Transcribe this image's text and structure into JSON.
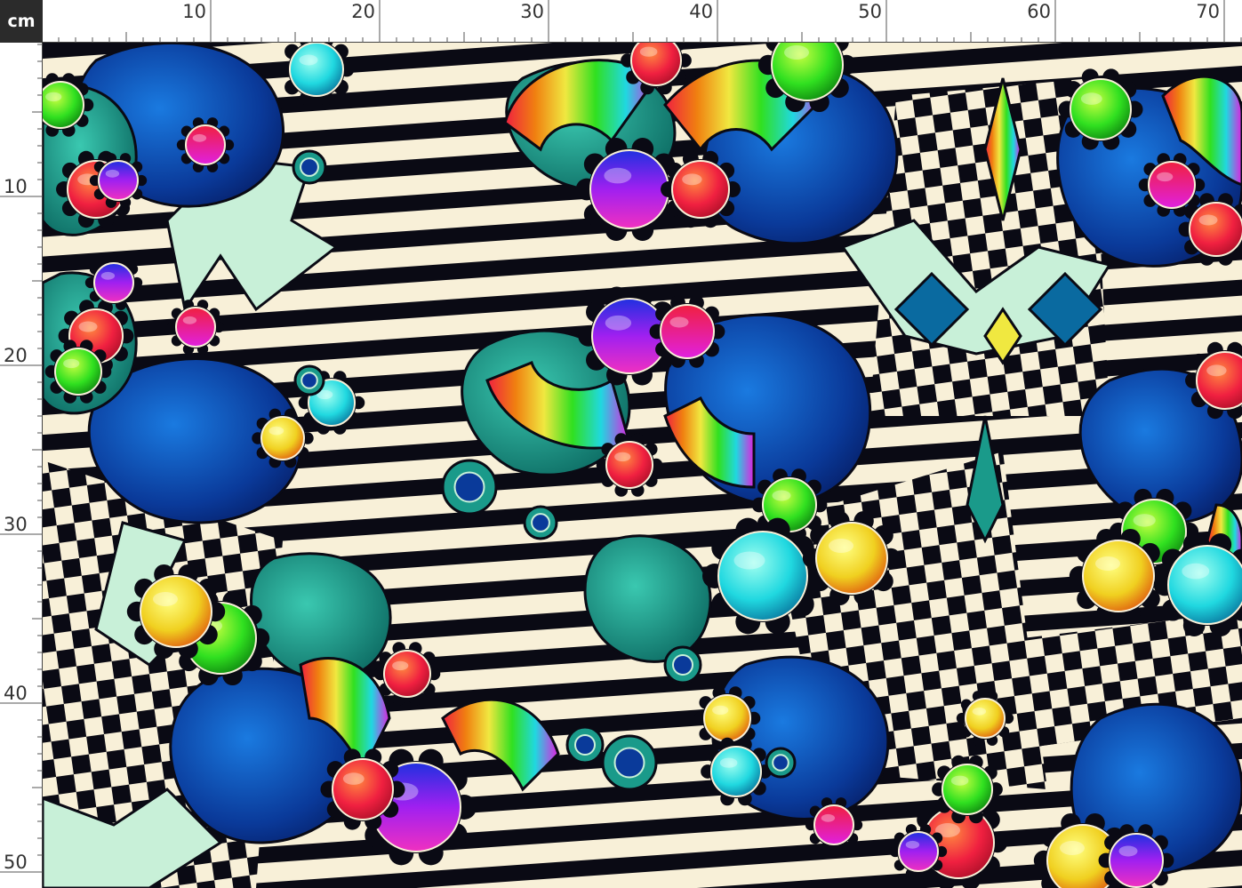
{
  "ruler": {
    "unit": "cm",
    "top_labels": [
      "10",
      "20",
      "30",
      "40",
      "50",
      "60",
      "70"
    ],
    "left_labels": [
      "10",
      "20",
      "30",
      "40",
      "50"
    ]
  },
  "fabric": {
    "colors": {
      "cream": "#f8f0d8",
      "black": "#0a0a14",
      "teal": "#1a9a8a",
      "deep_blue": "#0a3a9a",
      "light_teal": "#8ae0c8",
      "yellow": "#f0e840",
      "green": "#30e020",
      "cyan": "#20d8e0",
      "red": "#f02040",
      "orange": "#f08010",
      "magenta": "#e020e0",
      "purple": "#7020f0"
    }
  }
}
